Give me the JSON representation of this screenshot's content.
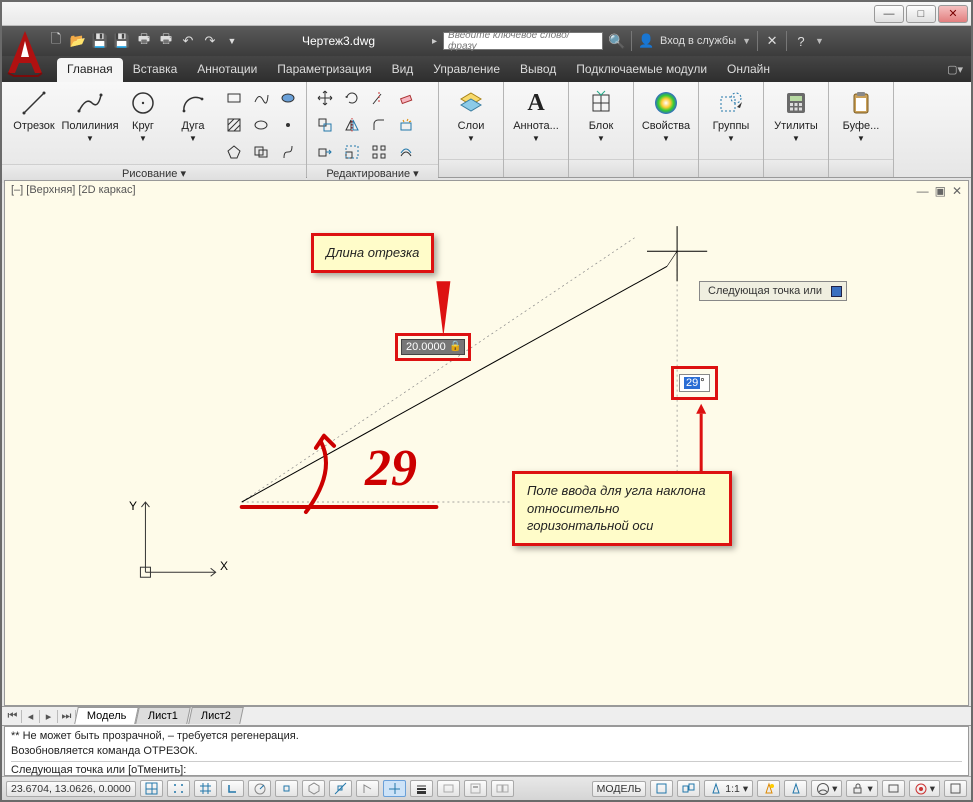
{
  "qa": {
    "doc_title": "Чертеж3.dwg",
    "search_placeholder": "Введите ключевое слово/фразу",
    "signin": "Вход в службы"
  },
  "tabs": {
    "t0": "Главная",
    "t1": "Вставка",
    "t2": "Аннотации",
    "t3": "Параметризация",
    "t4": "Вид",
    "t5": "Управление",
    "t6": "Вывод",
    "t7": "Подключаемые модули",
    "t8": "Онлайн"
  },
  "panel": {
    "draw": {
      "label": "Рисование ▾",
      "b0": "Отрезок",
      "b1": "Полилиния",
      "b2": "Круг",
      "b3": "Дуга"
    },
    "edit": {
      "label": "Редактирование ▾"
    },
    "layers": "Слои",
    "annot": "Аннота...",
    "block": "Блок",
    "props": "Свойства",
    "groups": "Группы",
    "utils": "Утилиты",
    "clip": "Буфе..."
  },
  "viewport": {
    "label": "[–] [Верхняя] [2D каркас]"
  },
  "callouts": {
    "length": "Длина отрезка",
    "angle": "Поле ввода для угла наклона относительно горизонтальной оси"
  },
  "dyn": {
    "length_value": "20.0000",
    "angle_value": "29",
    "tooltip": "Следующая точка или",
    "hand": "29"
  },
  "axes": {
    "x": "X",
    "y": "Y"
  },
  "model_tabs": {
    "t0": "Модель",
    "t1": "Лист1",
    "t2": "Лист2"
  },
  "cmd": {
    "l1": "** Не может быть прозрачной, – требуется регенерация.",
    "l2": "Возобновляется команда ОТРЕЗОК.",
    "prompt": "Следующая точка или [оТменить]:"
  },
  "status": {
    "coords": "23.6704, 13.0626, 0.0000",
    "model": "МОДЕЛЬ",
    "scale": "1:1"
  }
}
